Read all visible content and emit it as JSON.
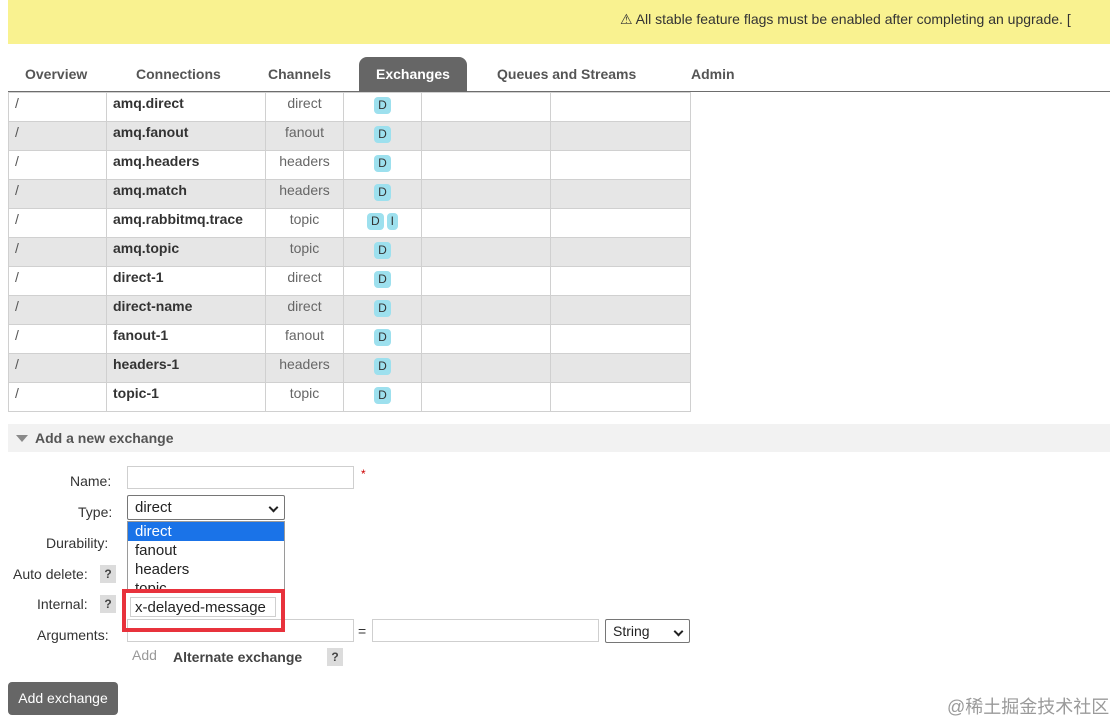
{
  "banner": {
    "text": "⚠ All stable feature flags must be enabled after completing an upgrade. ["
  },
  "tabs": [
    {
      "label": "Overview",
      "active": false
    },
    {
      "label": "Connections",
      "active": false
    },
    {
      "label": "Channels",
      "active": false
    },
    {
      "label": "Exchanges",
      "active": true
    },
    {
      "label": "Queues and Streams",
      "active": false
    },
    {
      "label": "Admin",
      "active": false
    }
  ],
  "exchanges": [
    {
      "vhost": "/",
      "name": "amq.direct",
      "type": "direct",
      "features": [
        "D"
      ]
    },
    {
      "vhost": "/",
      "name": "amq.fanout",
      "type": "fanout",
      "features": [
        "D"
      ]
    },
    {
      "vhost": "/",
      "name": "amq.headers",
      "type": "headers",
      "features": [
        "D"
      ]
    },
    {
      "vhost": "/",
      "name": "amq.match",
      "type": "headers",
      "features": [
        "D"
      ]
    },
    {
      "vhost": "/",
      "name": "amq.rabbitmq.trace",
      "type": "topic",
      "features": [
        "D",
        "I"
      ]
    },
    {
      "vhost": "/",
      "name": "amq.topic",
      "type": "topic",
      "features": [
        "D"
      ]
    },
    {
      "vhost": "/",
      "name": "direct-1",
      "type": "direct",
      "features": [
        "D"
      ]
    },
    {
      "vhost": "/",
      "name": "direct-name",
      "type": "direct",
      "features": [
        "D"
      ]
    },
    {
      "vhost": "/",
      "name": "fanout-1",
      "type": "fanout",
      "features": [
        "D"
      ]
    },
    {
      "vhost": "/",
      "name": "headers-1",
      "type": "headers",
      "features": [
        "D"
      ]
    },
    {
      "vhost": "/",
      "name": "topic-1",
      "type": "topic",
      "features": [
        "D"
      ]
    }
  ],
  "add_section": {
    "title": "Add a new exchange",
    "labels": {
      "name": "Name:",
      "type": "Type:",
      "durability": "Durability:",
      "auto_delete": "Auto delete:",
      "internal": "Internal:",
      "arguments": "Arguments:"
    },
    "required_mark": "*",
    "help": "?",
    "type_select": {
      "value": "direct",
      "options": [
        "direct",
        "fanout",
        "headers",
        "topic"
      ],
      "highlighted_option": "x-delayed-message"
    },
    "arguments": {
      "equals": "=",
      "value_type": "String"
    },
    "add_link": "Add",
    "alternate_exchange": "Alternate exchange",
    "submit_label": "Add exchange"
  },
  "watermark": "@稀土掘金技术社区",
  "colors": {
    "banner_bg": "#f9f290",
    "tab_active_bg": "#666666",
    "badge_bg": "#9de0ee",
    "highlight_border": "#e8323c",
    "dropdown_selected": "#1a73e8"
  }
}
